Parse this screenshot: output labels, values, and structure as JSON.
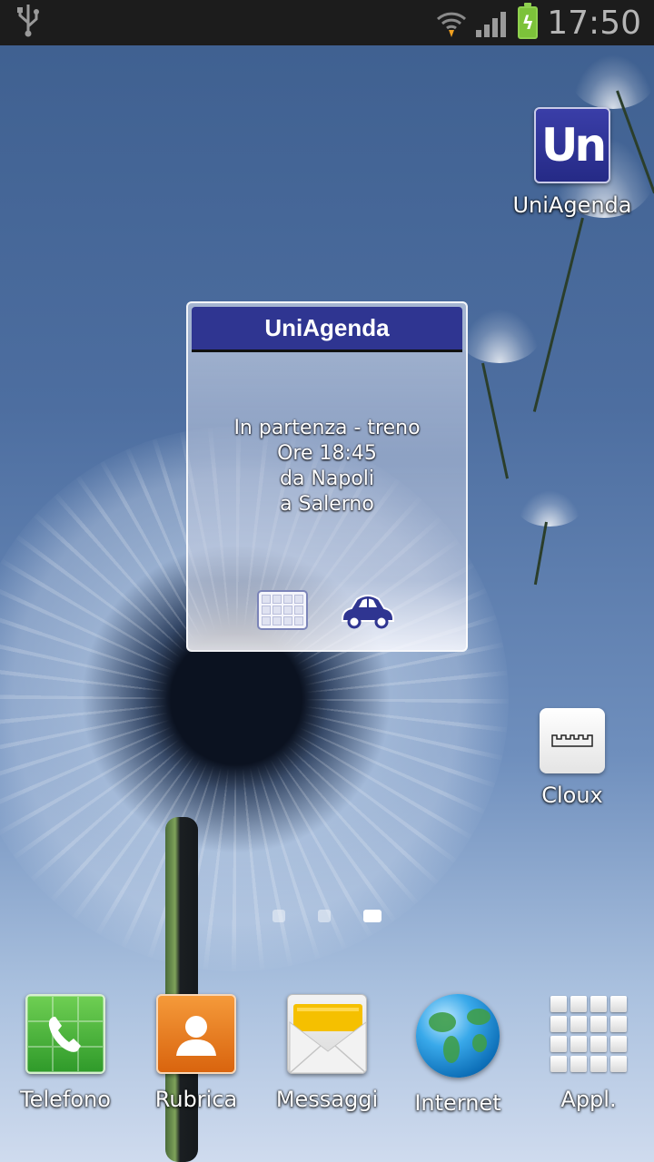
{
  "status_bar": {
    "time": "17:50",
    "icons": [
      "usb-icon",
      "wifi-icon",
      "signal-icon",
      "battery-charging-icon"
    ]
  },
  "home_apps": {
    "uniagenda_icon_text": "Un",
    "uniagenda_label": "UniAgenda",
    "cloux_label": "Cloux"
  },
  "widget": {
    "title": "UniAgenda",
    "lines": [
      "In partenza - treno",
      "Ore 18:45",
      "da Napoli",
      "a Salerno"
    ],
    "actions": [
      "calendar-icon",
      "car-icon"
    ]
  },
  "page_indicator": {
    "count": 3,
    "active_index": 2
  },
  "dock": {
    "items": [
      {
        "label": "Telefono",
        "icon": "phone-icon"
      },
      {
        "label": "Rubrica",
        "icon": "contacts-icon"
      },
      {
        "label": "Messaggi",
        "icon": "messages-icon"
      },
      {
        "label": "Internet",
        "icon": "globe-icon"
      },
      {
        "label": "Appl.",
        "icon": "apps-grid-icon"
      }
    ]
  },
  "colors": {
    "widget_header": "#2f3591",
    "status_bar": "#1c1c1c",
    "battery": "#7cc23a"
  }
}
